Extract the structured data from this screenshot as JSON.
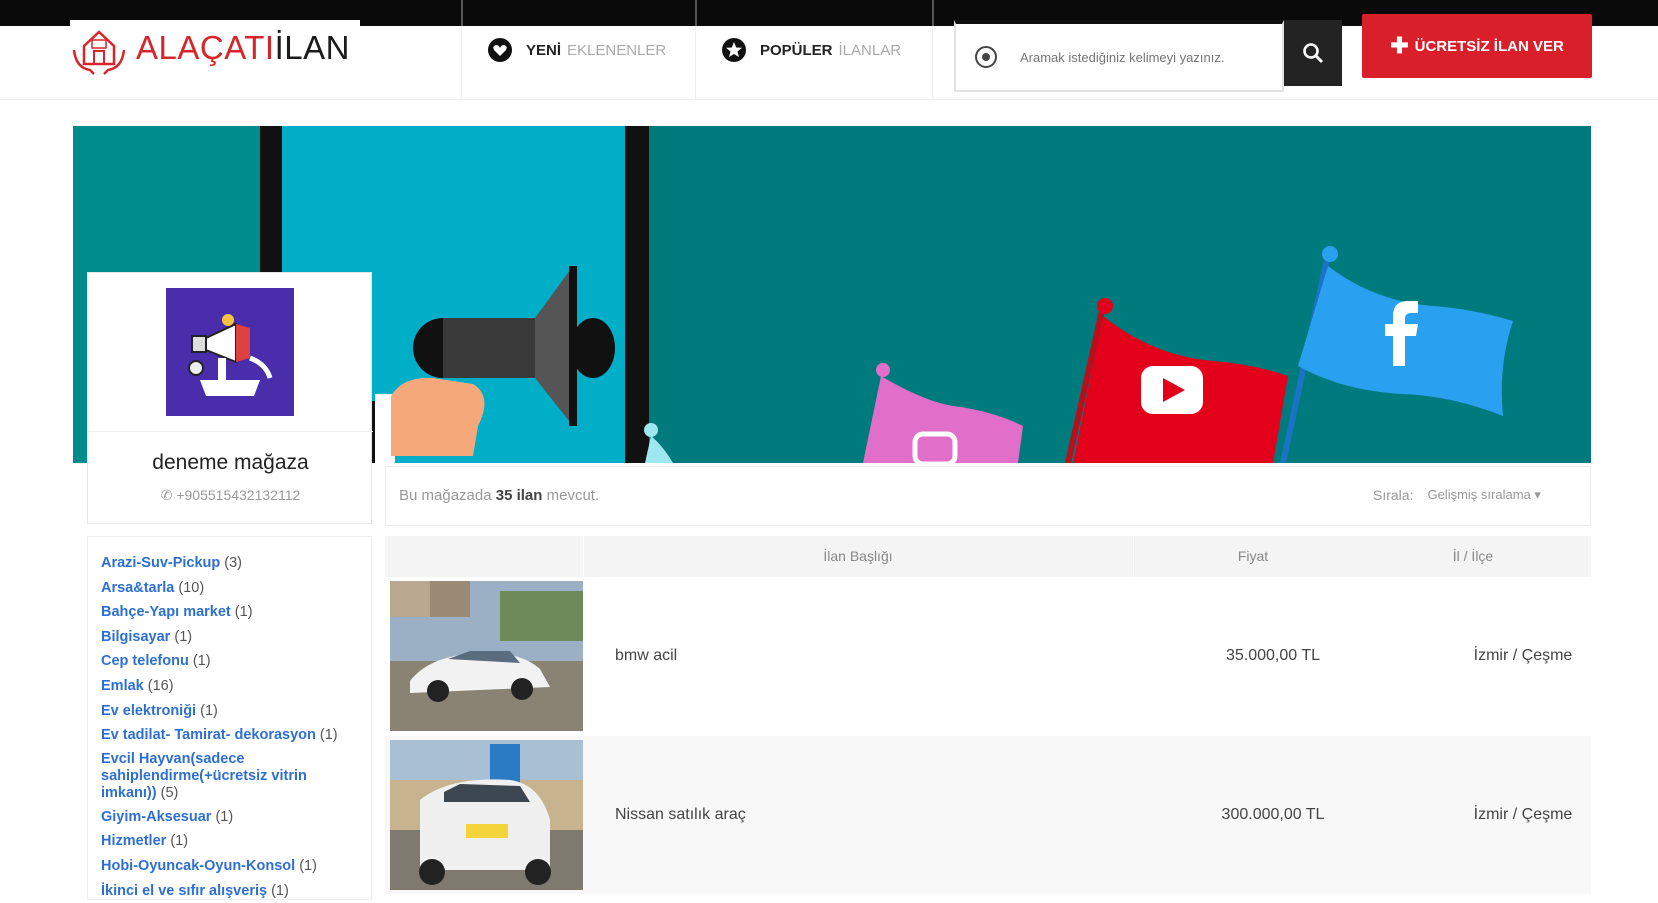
{
  "header": {
    "logo": {
      "part1": "ALAÇATI",
      "part2": "İLAN"
    },
    "nav": [
      {
        "bold": "YENİ",
        "light": "EKLENENLER",
        "icon": "heart-icon"
      },
      {
        "bold": "POPÜLER",
        "light": "İLANLAR",
        "icon": "star-icon"
      }
    ],
    "search": {
      "placeholder": "Aramak istediğiniz kelimeyi yazınız.",
      "icon": "target-icon",
      "button_icon": "search-icon"
    },
    "cta_label": "ÜCRETSİZ İLAN VER"
  },
  "store": {
    "name": "deneme mağaza",
    "phone": "+905515432132112",
    "avatar_color": "#4a2dab"
  },
  "info": {
    "prefix": "Bu mağazada",
    "count": "35 ilan",
    "suffix": "mevcut.",
    "sort_label": "Sırala:",
    "sort_value": "Gelişmiş sıralama"
  },
  "categories": [
    {
      "name": "Arazi-Suv-Pickup",
      "count": "(3)"
    },
    {
      "name": "Arsa&tarla",
      "count": "(10)"
    },
    {
      "name": "Bahçe-Yapı market",
      "count": "(1)"
    },
    {
      "name": "Bilgisayar",
      "count": "(1)"
    },
    {
      "name": "Cep telefonu",
      "count": "(1)"
    },
    {
      "name": "Emlak",
      "count": "(16)"
    },
    {
      "name": "Ev elektroniği",
      "count": "(1)"
    },
    {
      "name": "Ev tadilat- Tamirat- dekorasyon",
      "count": "(1)"
    },
    {
      "name": "Evcil Hayvan(sadece sahiplendirme(+ücretsiz vitrin imkanı))",
      "count": "(5)"
    },
    {
      "name": "Giyim-Aksesuar",
      "count": "(1)"
    },
    {
      "name": "Hizmetler",
      "count": "(1)"
    },
    {
      "name": "Hobi-Oyuncak-Oyun-Konsol",
      "count": "(1)"
    },
    {
      "name": "İkinci el ve sıfır alışveriş",
      "count": "(1)"
    }
  ],
  "table": {
    "headers": [
      "İlan Başlığı",
      "Fiyat",
      "İl / İlçe"
    ],
    "rows": [
      {
        "title": "bmw acil",
        "price": "35.000,00 TL",
        "location": "İzmir / Çeşme"
      },
      {
        "title": "Nissan satılık araç",
        "price": "300.000,00 TL",
        "location": "İzmir / Çeşme"
      }
    ]
  },
  "colors": {
    "brand_red": "#d9202a",
    "link_blue": "#2d6fd4",
    "banner_teal": "#007b7d",
    "banner_cyan": "#00aec8"
  }
}
